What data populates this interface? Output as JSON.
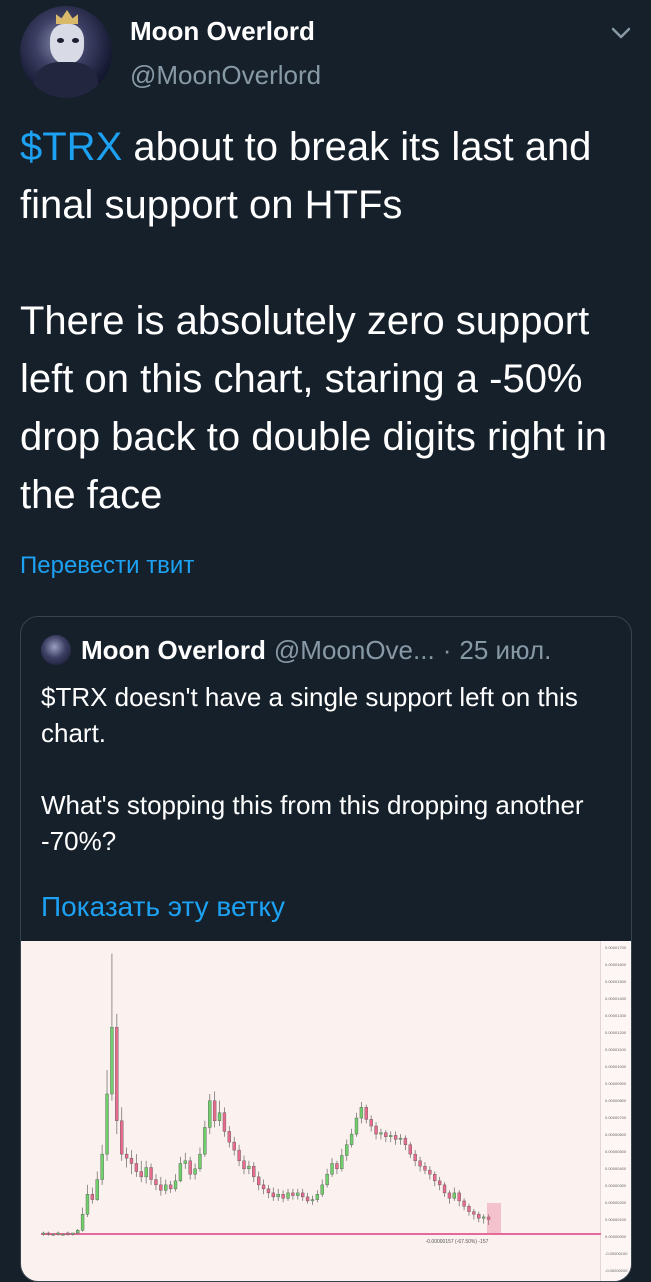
{
  "tweet": {
    "author_name": "Moon Overlord",
    "author_handle": "@MoonOverlord",
    "avatar_icon": "crowned-figure-avatar",
    "menu_icon": "chevron-down-icon",
    "text_cashtag": "$TRX",
    "text_rest": " about to break its last and final support on HTFs\n\nThere is absolutely zero support left on this chart, staring a -50% drop back to double digits right in the face",
    "translate_label": "Перевести твит"
  },
  "quoted": {
    "author_name": "Moon Overlord",
    "author_handle": "@MoonOve...",
    "separator": "·",
    "date": "25 июл.",
    "text": "$TRX doesn't have a single support left on this chart.\n\nWhat's stopping this from this dropping another -70%?",
    "thread_link": "Показать эту ветку",
    "chart_data": {
      "type": "candlestick",
      "title": "",
      "support_line_color": "#e36a9a",
      "up_color": "#6fcf6a",
      "down_color": "#e86b8e",
      "annotation": "-0.00000157 (-67.50%) -157",
      "y_ticks": [
        "0.00001700",
        "0.00001600",
        "0.00001500",
        "0.00001400",
        "0.00001300",
        "0.00001200",
        "0.00001100",
        "0.00001000",
        "0.00000900",
        "0.00000800",
        "0.00000700",
        "0.00000600",
        "0.00000500",
        "0.00000400",
        "0.00000300",
        "0.00000200",
        "0.00000100",
        "0.00000000",
        "-0.00000100",
        "-0.00000200"
      ],
      "candles": [
        {
          "o": 0.5,
          "c": 0.6,
          "h": 0.7,
          "l": 0.4
        },
        {
          "o": 0.6,
          "c": 0.5,
          "h": 0.7,
          "l": 0.4
        },
        {
          "o": 0.5,
          "c": 0.5,
          "h": 0.6,
          "l": 0.4
        },
        {
          "o": 0.5,
          "c": 0.6,
          "h": 0.7,
          "l": 0.4
        },
        {
          "o": 0.5,
          "c": 0.5,
          "h": 0.6,
          "l": 0.4
        },
        {
          "o": 0.6,
          "c": 0.5,
          "h": 0.7,
          "l": 0.4
        },
        {
          "o": 0.5,
          "c": 0.6,
          "h": 0.6,
          "l": 0.4
        },
        {
          "o": 0.6,
          "c": 0.8,
          "h": 0.9,
          "l": 0.5
        },
        {
          "o": 0.8,
          "c": 2.0,
          "h": 2.5,
          "l": 0.7
        },
        {
          "o": 2.0,
          "c": 3.5,
          "h": 4.2,
          "l": 1.8
        },
        {
          "o": 3.5,
          "c": 3.1,
          "h": 4.0,
          "l": 2.8
        },
        {
          "o": 3.1,
          "c": 4.6,
          "h": 5.2,
          "l": 3.0
        },
        {
          "o": 4.6,
          "c": 6.5,
          "h": 7.2,
          "l": 4.2
        },
        {
          "o": 6.5,
          "c": 11.0,
          "h": 12.8,
          "l": 6.0
        },
        {
          "o": 11.0,
          "c": 16.0,
          "h": 21.5,
          "l": 10.5
        },
        {
          "o": 16.0,
          "c": 9.0,
          "h": 17.0,
          "l": 8.0
        },
        {
          "o": 9.0,
          "c": 6.5,
          "h": 10.0,
          "l": 6.0
        },
        {
          "o": 6.5,
          "c": 6.2,
          "h": 7.0,
          "l": 5.5
        },
        {
          "o": 6.2,
          "c": 5.8,
          "h": 6.8,
          "l": 5.0
        },
        {
          "o": 5.8,
          "c": 5.2,
          "h": 6.5,
          "l": 4.8
        },
        {
          "o": 5.2,
          "c": 4.8,
          "h": 6.0,
          "l": 4.4
        },
        {
          "o": 4.8,
          "c": 5.5,
          "h": 6.0,
          "l": 4.3
        },
        {
          "o": 5.5,
          "c": 4.6,
          "h": 5.8,
          "l": 4.2
        },
        {
          "o": 4.6,
          "c": 4.2,
          "h": 5.0,
          "l": 3.8
        },
        {
          "o": 4.2,
          "c": 3.8,
          "h": 4.8,
          "l": 3.4
        },
        {
          "o": 3.8,
          "c": 4.2,
          "h": 4.6,
          "l": 3.5
        },
        {
          "o": 4.2,
          "c": 3.9,
          "h": 4.5,
          "l": 3.6
        },
        {
          "o": 3.9,
          "c": 4.5,
          "h": 5.0,
          "l": 3.7
        },
        {
          "o": 4.5,
          "c": 5.8,
          "h": 6.3,
          "l": 4.4
        },
        {
          "o": 5.8,
          "c": 6.0,
          "h": 6.6,
          "l": 5.4
        },
        {
          "o": 6.0,
          "c": 5.0,
          "h": 6.3,
          "l": 4.6
        },
        {
          "o": 5.0,
          "c": 5.4,
          "h": 5.8,
          "l": 4.6
        },
        {
          "o": 5.4,
          "c": 6.5,
          "h": 7.0,
          "l": 5.2
        },
        {
          "o": 6.5,
          "c": 8.5,
          "h": 9.0,
          "l": 6.3
        },
        {
          "o": 8.5,
          "c": 10.5,
          "h": 11.0,
          "l": 8.0
        },
        {
          "o": 10.5,
          "c": 9.0,
          "h": 11.2,
          "l": 8.5
        },
        {
          "o": 9.0,
          "c": 9.6,
          "h": 10.5,
          "l": 8.6
        },
        {
          "o": 9.6,
          "c": 8.2,
          "h": 10.0,
          "l": 7.8
        },
        {
          "o": 8.2,
          "c": 7.4,
          "h": 8.6,
          "l": 7.0
        },
        {
          "o": 7.4,
          "c": 6.8,
          "h": 7.8,
          "l": 6.4
        },
        {
          "o": 6.8,
          "c": 6.0,
          "h": 7.2,
          "l": 5.6
        },
        {
          "o": 6.0,
          "c": 5.4,
          "h": 6.4,
          "l": 5.0
        },
        {
          "o": 5.4,
          "c": 5.6,
          "h": 6.0,
          "l": 5.0
        },
        {
          "o": 5.6,
          "c": 4.8,
          "h": 5.9,
          "l": 4.4
        },
        {
          "o": 4.8,
          "c": 4.2,
          "h": 5.2,
          "l": 3.8
        },
        {
          "o": 4.2,
          "c": 3.9,
          "h": 4.6,
          "l": 3.5
        },
        {
          "o": 3.9,
          "c": 3.6,
          "h": 4.2,
          "l": 3.2
        },
        {
          "o": 3.6,
          "c": 3.3,
          "h": 4.0,
          "l": 3.0
        },
        {
          "o": 3.3,
          "c": 3.5,
          "h": 3.9,
          "l": 3.0
        },
        {
          "o": 3.5,
          "c": 3.2,
          "h": 3.8,
          "l": 2.9
        },
        {
          "o": 3.2,
          "c": 3.6,
          "h": 3.9,
          "l": 3.0
        },
        {
          "o": 3.6,
          "c": 3.4,
          "h": 3.9,
          "l": 3.1
        },
        {
          "o": 3.4,
          "c": 3.6,
          "h": 3.9,
          "l": 3.1
        },
        {
          "o": 3.6,
          "c": 3.3,
          "h": 3.9,
          "l": 3.0
        },
        {
          "o": 3.3,
          "c": 3.0,
          "h": 3.6,
          "l": 2.8
        },
        {
          "o": 3.0,
          "c": 3.1,
          "h": 3.4,
          "l": 2.7
        },
        {
          "o": 3.1,
          "c": 3.5,
          "h": 3.8,
          "l": 2.9
        },
        {
          "o": 3.5,
          "c": 4.2,
          "h": 4.6,
          "l": 3.3
        },
        {
          "o": 4.2,
          "c": 5.0,
          "h": 5.4,
          "l": 4.0
        },
        {
          "o": 5.0,
          "c": 5.8,
          "h": 6.2,
          "l": 4.8
        },
        {
          "o": 5.8,
          "c": 5.4,
          "h": 6.0,
          "l": 5.0
        },
        {
          "o": 5.4,
          "c": 6.4,
          "h": 6.9,
          "l": 5.2
        },
        {
          "o": 6.4,
          "c": 7.2,
          "h": 7.6,
          "l": 6.0
        },
        {
          "o": 7.2,
          "c": 8.0,
          "h": 8.4,
          "l": 7.0
        },
        {
          "o": 8.0,
          "c": 9.2,
          "h": 9.6,
          "l": 7.8
        },
        {
          "o": 9.2,
          "c": 10.0,
          "h": 10.4,
          "l": 8.8
        },
        {
          "o": 10.0,
          "c": 9.1,
          "h": 10.2,
          "l": 8.8
        },
        {
          "o": 9.1,
          "c": 8.6,
          "h": 9.4,
          "l": 8.2
        },
        {
          "o": 8.6,
          "c": 8.0,
          "h": 8.9,
          "l": 7.6
        },
        {
          "o": 8.0,
          "c": 8.1,
          "h": 8.4,
          "l": 7.6
        },
        {
          "o": 8.1,
          "c": 7.8,
          "h": 8.3,
          "l": 7.4
        },
        {
          "o": 7.8,
          "c": 7.9,
          "h": 8.2,
          "l": 7.4
        },
        {
          "o": 7.9,
          "c": 7.6,
          "h": 8.2,
          "l": 7.2
        },
        {
          "o": 7.6,
          "c": 7.7,
          "h": 8.0,
          "l": 7.2
        },
        {
          "o": 7.7,
          "c": 7.2,
          "h": 7.9,
          "l": 6.8
        },
        {
          "o": 7.2,
          "c": 6.5,
          "h": 7.4,
          "l": 6.2
        },
        {
          "o": 6.5,
          "c": 6.0,
          "h": 6.8,
          "l": 5.6
        },
        {
          "o": 6.0,
          "c": 5.6,
          "h": 6.3,
          "l": 5.2
        },
        {
          "o": 5.6,
          "c": 5.3,
          "h": 5.9,
          "l": 5.0
        },
        {
          "o": 5.3,
          "c": 5.0,
          "h": 5.6,
          "l": 4.6
        },
        {
          "o": 5.0,
          "c": 4.5,
          "h": 5.2,
          "l": 4.1
        },
        {
          "o": 4.5,
          "c": 4.2,
          "h": 4.8,
          "l": 3.8
        },
        {
          "o": 4.2,
          "c": 3.6,
          "h": 4.4,
          "l": 3.3
        },
        {
          "o": 3.6,
          "c": 3.2,
          "h": 3.8,
          "l": 2.8
        },
        {
          "o": 3.2,
          "c": 3.6,
          "h": 4.0,
          "l": 3.0
        },
        {
          "o": 3.6,
          "c": 3.0,
          "h": 3.8,
          "l": 2.6
        },
        {
          "o": 3.0,
          "c": 2.6,
          "h": 3.2,
          "l": 2.3
        },
        {
          "o": 2.6,
          "c": 2.2,
          "h": 2.8,
          "l": 1.9
        },
        {
          "o": 2.2,
          "c": 2.0,
          "h": 2.4,
          "l": 1.6
        },
        {
          "o": 2.0,
          "c": 1.7,
          "h": 2.2,
          "l": 1.4
        },
        {
          "o": 1.7,
          "c": 1.8,
          "h": 2.0,
          "l": 1.3
        },
        {
          "o": 1.8,
          "c": 1.6,
          "h": 2.0,
          "l": 1.2
        }
      ]
    }
  }
}
